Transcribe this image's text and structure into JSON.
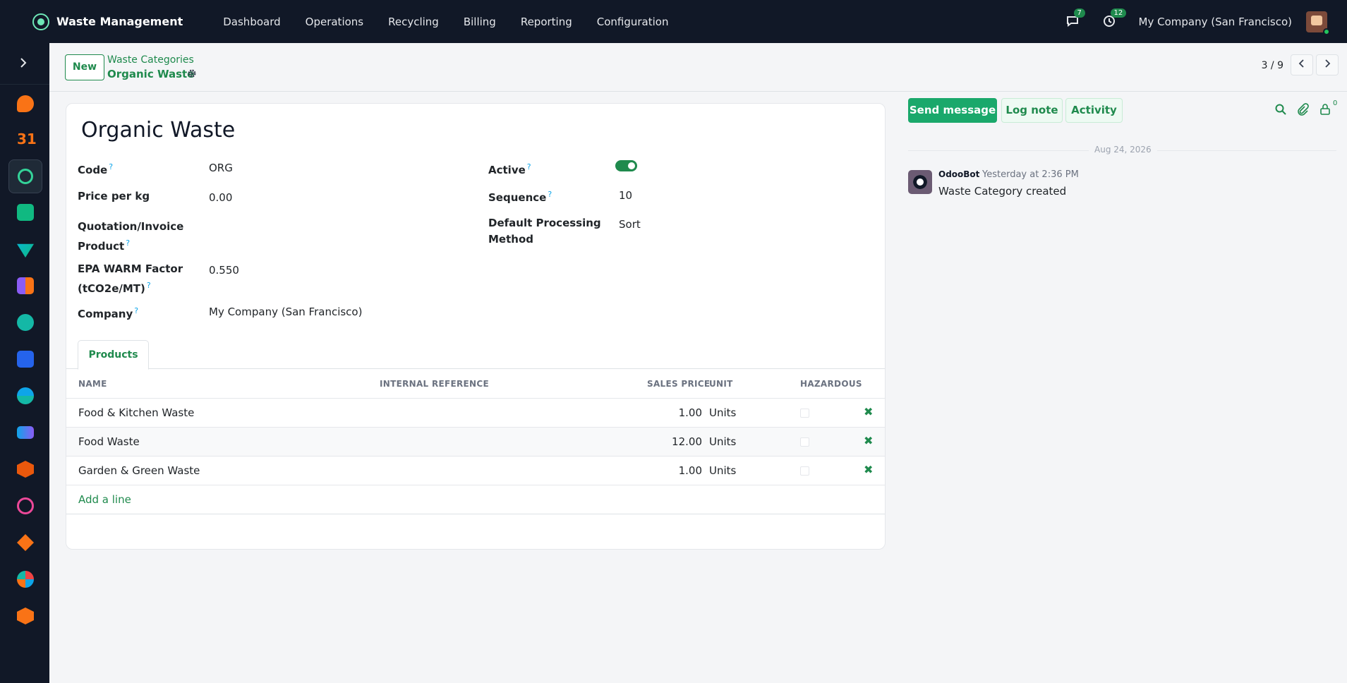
{
  "navbar": {
    "app_name": "Waste Management",
    "menu": [
      "Dashboard",
      "Operations",
      "Recycling",
      "Billing",
      "Reporting",
      "Configuration"
    ],
    "messages_count": "7",
    "activities_count": "12",
    "company": "My Company (San Francisco)"
  },
  "breadcrumb": {
    "new_label": "New",
    "parent": "Waste Categories",
    "current": "Organic Waste"
  },
  "pager": {
    "value": "3 / 9"
  },
  "form": {
    "title": "Organic Waste",
    "left_fields": [
      {
        "label": "Code",
        "help": "?",
        "value": "ORG"
      },
      {
        "label": "Price per kg",
        "help": "",
        "value": "0.00"
      },
      {
        "label_line1": "Quotation/Invoice",
        "label_line2": "Product",
        "help": "?",
        "value": ""
      },
      {
        "label_line1": "EPA WARM Factor",
        "label_line2": "(tCO2e/MT)",
        "help": "?",
        "value": "0.550"
      },
      {
        "label": "Company",
        "help": "?",
        "value": "My Company (San Francisco)"
      }
    ],
    "right_fields": [
      {
        "label": "Active",
        "help": "?",
        "value": true
      },
      {
        "label": "Sequence",
        "help": "?",
        "value": "10"
      },
      {
        "label_line1": "Default Processing",
        "label_line2": "Method",
        "value": "Sort"
      }
    ]
  },
  "tabs": [
    {
      "label": "Products"
    }
  ],
  "products_table": {
    "headers": [
      "NAME",
      "INTERNAL REFERENCE",
      "SALES PRICE",
      "UNIT",
      "HAZARDOUS"
    ],
    "rows": [
      {
        "name": "Food & Kitchen Waste",
        "internal_reference": "",
        "sales_price": "1.00",
        "unit": "Units",
        "hazardous": false
      },
      {
        "name": "Food Waste",
        "internal_reference": "",
        "sales_price": "12.00",
        "unit": "Units",
        "hazardous": false
      },
      {
        "name": "Garden & Green Waste",
        "internal_reference": "",
        "sales_price": "1.00",
        "unit": "Units",
        "hazardous": false
      }
    ],
    "add_line": "Add a line"
  },
  "chatter": {
    "send_message": "Send message",
    "log_note": "Log note",
    "activity": "Activity",
    "followers_count": "0",
    "date_separator": "Aug 24, 2026",
    "messages": [
      {
        "author": "OdooBot",
        "time": "Yesterday at 2:36 PM",
        "body": "Waste Category created"
      }
    ]
  },
  "colors": {
    "navbar_bg": "#111827",
    "accent_green": "#1f8a4d",
    "primary_button": "#1aa86b"
  }
}
